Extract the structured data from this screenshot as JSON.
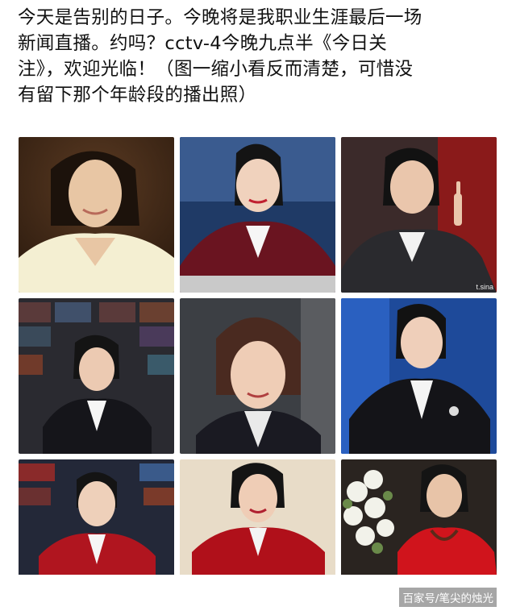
{
  "post": {
    "lines": [
      "今天是告别的日子。今晚将是我职业生涯最后一场",
      "新闻直播。约吗？cctv-4今晚九点半《今日关",
      "注》，欢迎光临！（图一缩小看反而清楚，可惜没",
      "有留下那个年龄段的播出照）"
    ]
  },
  "photos": [
    {
      "id": "p1",
      "watermark": ""
    },
    {
      "id": "p2",
      "watermark": ""
    },
    {
      "id": "p3",
      "watermark": "t.sina"
    },
    {
      "id": "p4",
      "watermark": ""
    },
    {
      "id": "p5",
      "watermark": ""
    },
    {
      "id": "p6",
      "watermark": ""
    },
    {
      "id": "p7",
      "watermark": ""
    },
    {
      "id": "p8",
      "watermark": ""
    },
    {
      "id": "p9",
      "watermark": ""
    }
  ],
  "credit": "百家号/笔尖的烛光",
  "colors": {
    "text": "#111111",
    "background": "#ffffff"
  }
}
